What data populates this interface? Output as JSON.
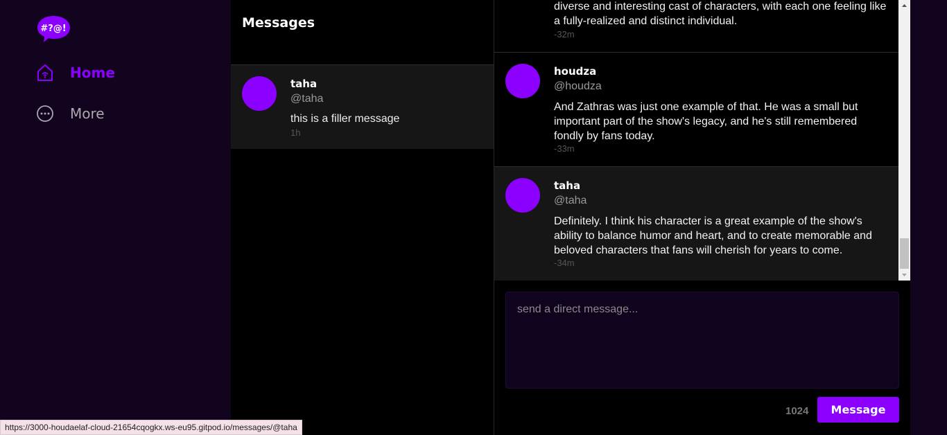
{
  "app": {
    "logo_text": "#?@!",
    "brand_color": "#8c00ff"
  },
  "sidebar": {
    "items": [
      {
        "label": "Home",
        "icon": "home-icon",
        "active": true
      },
      {
        "label": "More",
        "icon": "more-icon",
        "active": false
      }
    ]
  },
  "conversations": {
    "title": "Messages",
    "items": [
      {
        "name": "taha",
        "handle": "@taha",
        "text": "this is a filler message",
        "time": "1h"
      }
    ]
  },
  "thread": {
    "messages": [
      {
        "name": "",
        "handle": "",
        "text": "diverse and interesting cast of characters, with each one feeling like a fully-realized and distinct individual.",
        "time": "-32m"
      },
      {
        "name": "houdza",
        "handle": "@houdza",
        "text": "And Zathras was just one example of that. He was a small but important part of the show's legacy, and he's still remembered fondly by fans today.",
        "time": "-33m"
      },
      {
        "name": "taha",
        "handle": "@taha",
        "text": "Definitely. I think his character is a great example of the show's ability to balance humor and heart, and to create memorable and beloved characters that fans will cherish for years to come.",
        "time": "-34m"
      }
    ]
  },
  "composer": {
    "placeholder": "send a direct message...",
    "char_count": "1024",
    "send_label": "Message"
  },
  "status_bar": {
    "url": "https://3000-houdaelaf-cloud-21654cqogkx.ws-eu95.gitpod.io/messages/@taha"
  }
}
